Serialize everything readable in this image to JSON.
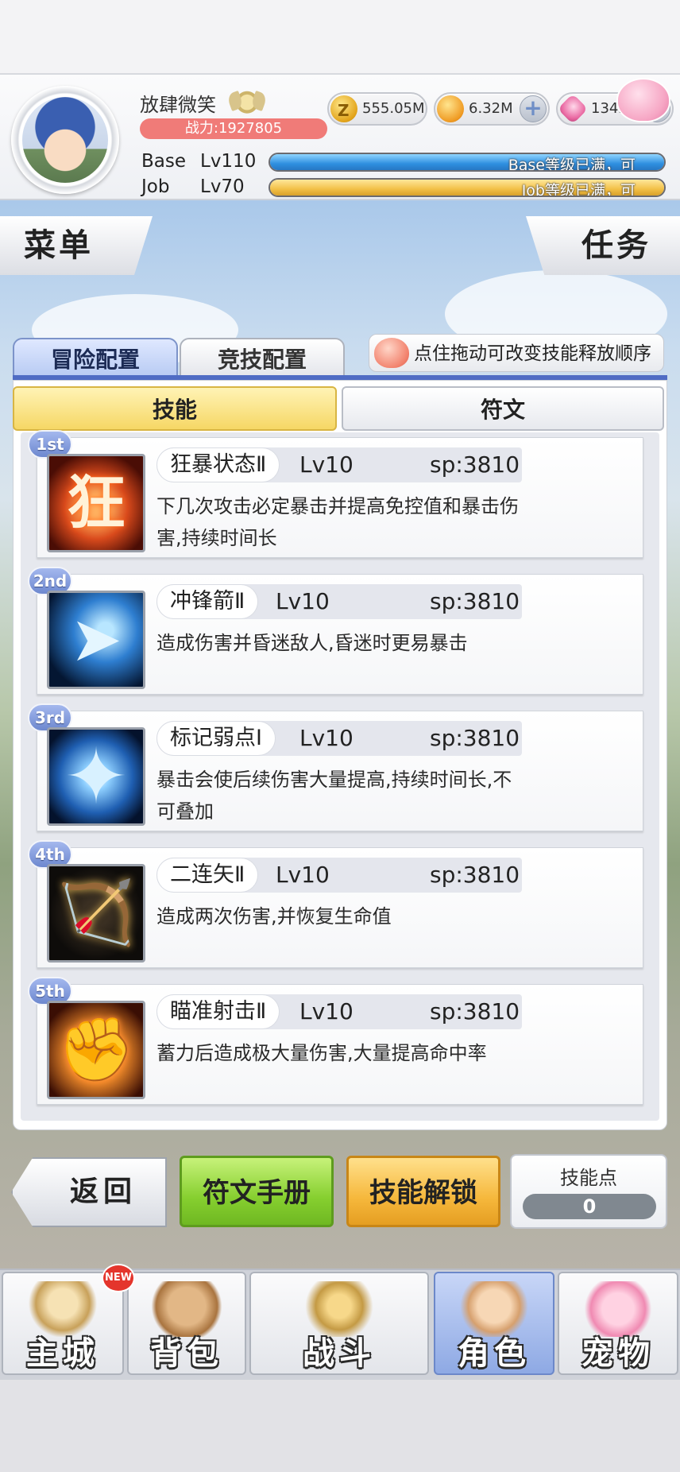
{
  "player": {
    "name": "放肆微笑",
    "power": "战力:1927805",
    "base_label": "Base",
    "base_level": "Lv110",
    "job_label": "Job",
    "job_level": "Lv70",
    "base_bar_text": "Base等级已满，可",
    "job_bar_text": "Job等级已满，可",
    "base_progress": 1.0,
    "job_progress": 1.0
  },
  "currencies": {
    "zeny": "555.05M",
    "coin": "6.32M",
    "gem": "13450",
    "plus": "+"
  },
  "side_buttons": {
    "menu": "菜单",
    "task": "任务"
  },
  "config_tabs": {
    "adventure": "冒险配置",
    "arena": "竞技配置",
    "hint": "点住拖动可改变技能释放顺序"
  },
  "sub_tabs": {
    "skill": "技能",
    "rune": "符文"
  },
  "skills": [
    {
      "rank": "1st",
      "name": "狂暴状态Ⅱ",
      "level": "Lv10",
      "sp": "sp:3810",
      "desc": "下几次攻击必定暴击并提高免控值和暴击伤害,持续时间长",
      "icon": "berserk-icon",
      "glyph": "狂"
    },
    {
      "rank": "2nd",
      "name": "冲锋箭Ⅱ",
      "level": "Lv10",
      "sp": "sp:3810",
      "desc": "造成伤害并昏迷敌人,昏迷时更易暴击",
      "icon": "charge-arrow-icon",
      "glyph": "➤"
    },
    {
      "rank": "3rd",
      "name": "标记弱点Ⅰ",
      "level": "Lv10",
      "sp": "sp:3810",
      "desc": "暴击会使后续伤害大量提高,持续时间长,不可叠加",
      "icon": "mark-weakness-icon",
      "glyph": "✦"
    },
    {
      "rank": "4th",
      "name": "二连矢Ⅱ",
      "level": "Lv10",
      "sp": "sp:3810",
      "desc": "造成两次伤害,并恢复生命值",
      "icon": "double-arrow-icon",
      "glyph": "🏹"
    },
    {
      "rank": "5th",
      "name": "瞄准射击Ⅱ",
      "level": "Lv10",
      "sp": "sp:3810",
      "desc": "蓄力后造成极大量伤害,大量提高命中率",
      "icon": "aimed-shot-icon",
      "glyph": "✊"
    }
  ],
  "actions": {
    "back": "返回",
    "rune_manual": "符文手册",
    "skill_unlock": "技能解锁",
    "skill_points_label": "技能点",
    "skill_points_value": "0"
  },
  "nav": {
    "new_badge": "NEW",
    "items": [
      {
        "label": "主城",
        "icon": "castle-icon"
      },
      {
        "label": "背包",
        "icon": "backpack-icon"
      },
      {
        "label": "战斗",
        "icon": "battle-icon"
      },
      {
        "label": "角色",
        "icon": "character-icon"
      },
      {
        "label": "宠物",
        "icon": "pet-icon"
      }
    ],
    "active_index": 3
  }
}
